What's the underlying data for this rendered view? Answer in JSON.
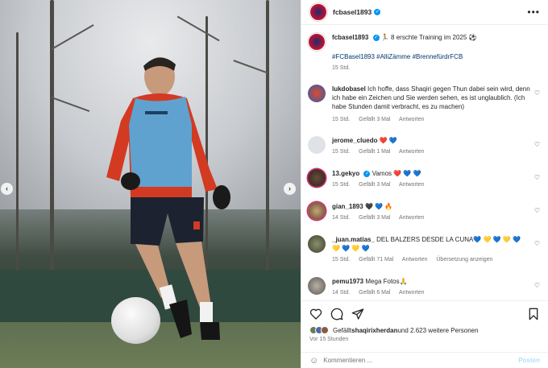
{
  "header": {
    "username": "fcbasel1893",
    "more_icon": "more-icon"
  },
  "caption": {
    "username": "fcbasel1893",
    "text": "🏃 8 erschte Training im 2025 ⚽",
    "tags": "#FCBasel1893 #AlliZämme #BrennefürdrFCB",
    "time": "15 Std."
  },
  "comments": [
    {
      "username": "lukdobasel",
      "text": "Ich hoffe, dass Shaqiri gegen Thun dabei sein wird, denn ich habe ein Zeichen und Sie werden sehen, es ist unglaublich. (Ich habe Stunden damit verbracht, es zu machen)",
      "time": "15 Std.",
      "likes": "Gefällt 3 Mal",
      "reply": "Antworten",
      "extra": ""
    },
    {
      "username": "jerome_cluedo",
      "text": "❤️ 💙",
      "time": "15 Std.",
      "likes": "Gefällt 1 Mal",
      "reply": "Antworten",
      "extra": ""
    },
    {
      "username": "13.gekyo",
      "text": "Vamos ❤️ 💙 💙",
      "time": "15 Std.",
      "likes": "Gefällt 3 Mal",
      "reply": "Antworten",
      "extra": ""
    },
    {
      "username": "gian_1893",
      "text": "🖤 💙 🔥",
      "time": "14 Std.",
      "likes": "Gefällt 3 Mal",
      "reply": "Antworten",
      "extra": ""
    },
    {
      "username": "_juan.matias_",
      "text": "DEL BALZERS DESDE LA CUNA💙 💛 💙 💛 💙 💛 💙 💛 💙",
      "time": "15 Std.",
      "likes": "Gefällt 71 Mal",
      "reply": "Antworten",
      "extra": "Übersetzung anzeigen"
    },
    {
      "username": "pemu1973",
      "text": "Mega Fotos🙏",
      "time": "14 Std.",
      "likes": "Gefällt 6 Mal",
      "reply": "Antworten",
      "extra": ""
    }
  ],
  "likes_line": {
    "prefix": "Gefällt ",
    "user": "shaqirixherdan",
    "suffix": " und 2.623 weitere Personen"
  },
  "posted_ago": "Vor 15 Stunden",
  "add_comment": {
    "placeholder": "Kommentieren ...",
    "post": "Posten"
  },
  "colors": {
    "accent": "#0095f6",
    "fcb_red": "#c8102e",
    "fcb_blue": "#1c2b6e"
  }
}
